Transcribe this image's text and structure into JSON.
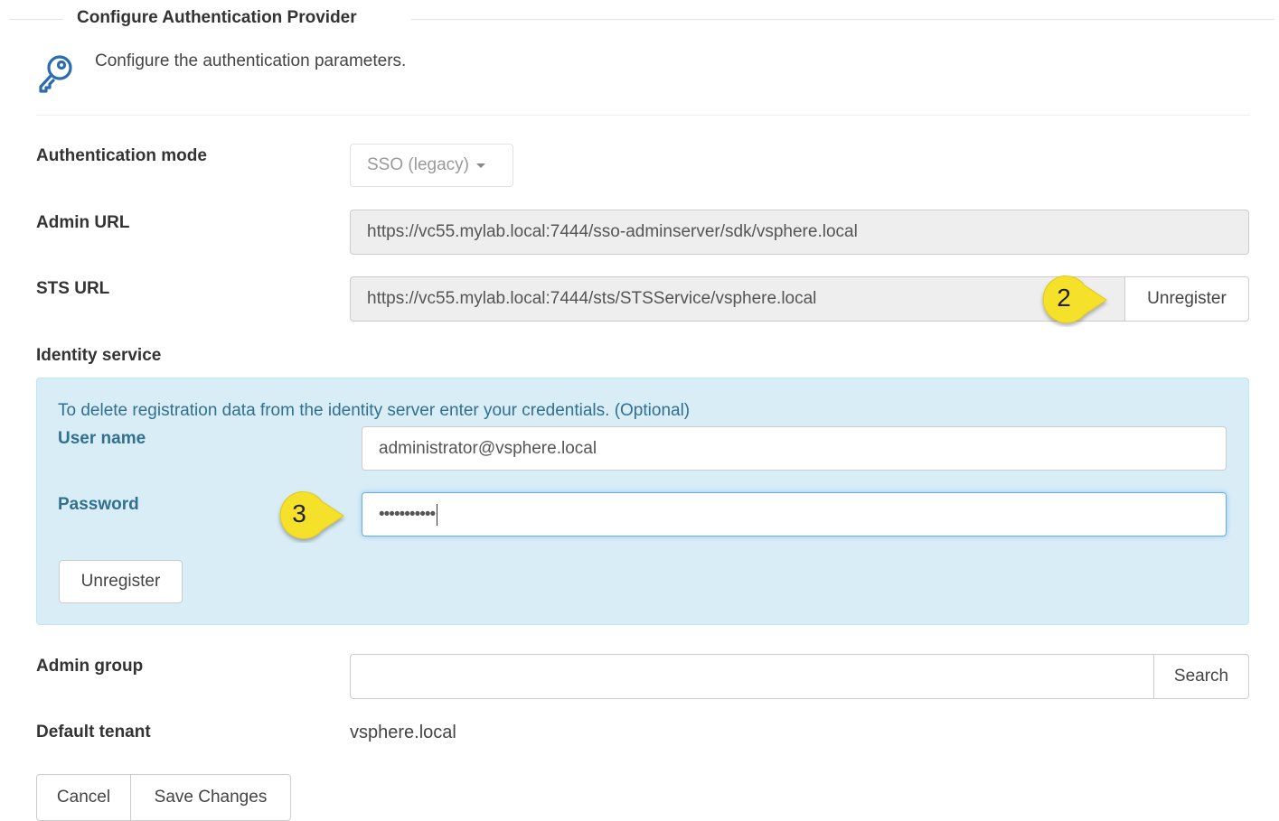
{
  "section_title": "Configure Authentication Provider",
  "intro": {
    "icon": "key-icon",
    "text": "Configure the authentication parameters."
  },
  "auth_mode": {
    "label": "Authentication mode",
    "value": "SSO (legacy)"
  },
  "admin_url": {
    "label": "Admin URL",
    "value": "https://vc55.mylab.local:7444/sso-adminserver/sdk/vsphere.local"
  },
  "sts_url": {
    "label": "STS URL",
    "value": "https://vc55.mylab.local:7444/sts/STSService/vsphere.local",
    "button": "Unregister"
  },
  "identity_service": {
    "label": "Identity service",
    "note": "To delete registration data from the identity server enter your credentials. (Optional)",
    "username_label": "User name",
    "username_value": "administrator@vsphere.local",
    "password_label": "Password",
    "password_value": "•••••••••••",
    "unregister_button": "Unregister"
  },
  "admin_group": {
    "label": "Admin group",
    "value": "",
    "search_button": "Search"
  },
  "default_tenant": {
    "label": "Default tenant",
    "value": "vsphere.local"
  },
  "footer": {
    "cancel": "Cancel",
    "save": "Save Changes"
  },
  "callouts": {
    "step_2": "2",
    "step_3": "3",
    "color": "#f5e12c"
  }
}
